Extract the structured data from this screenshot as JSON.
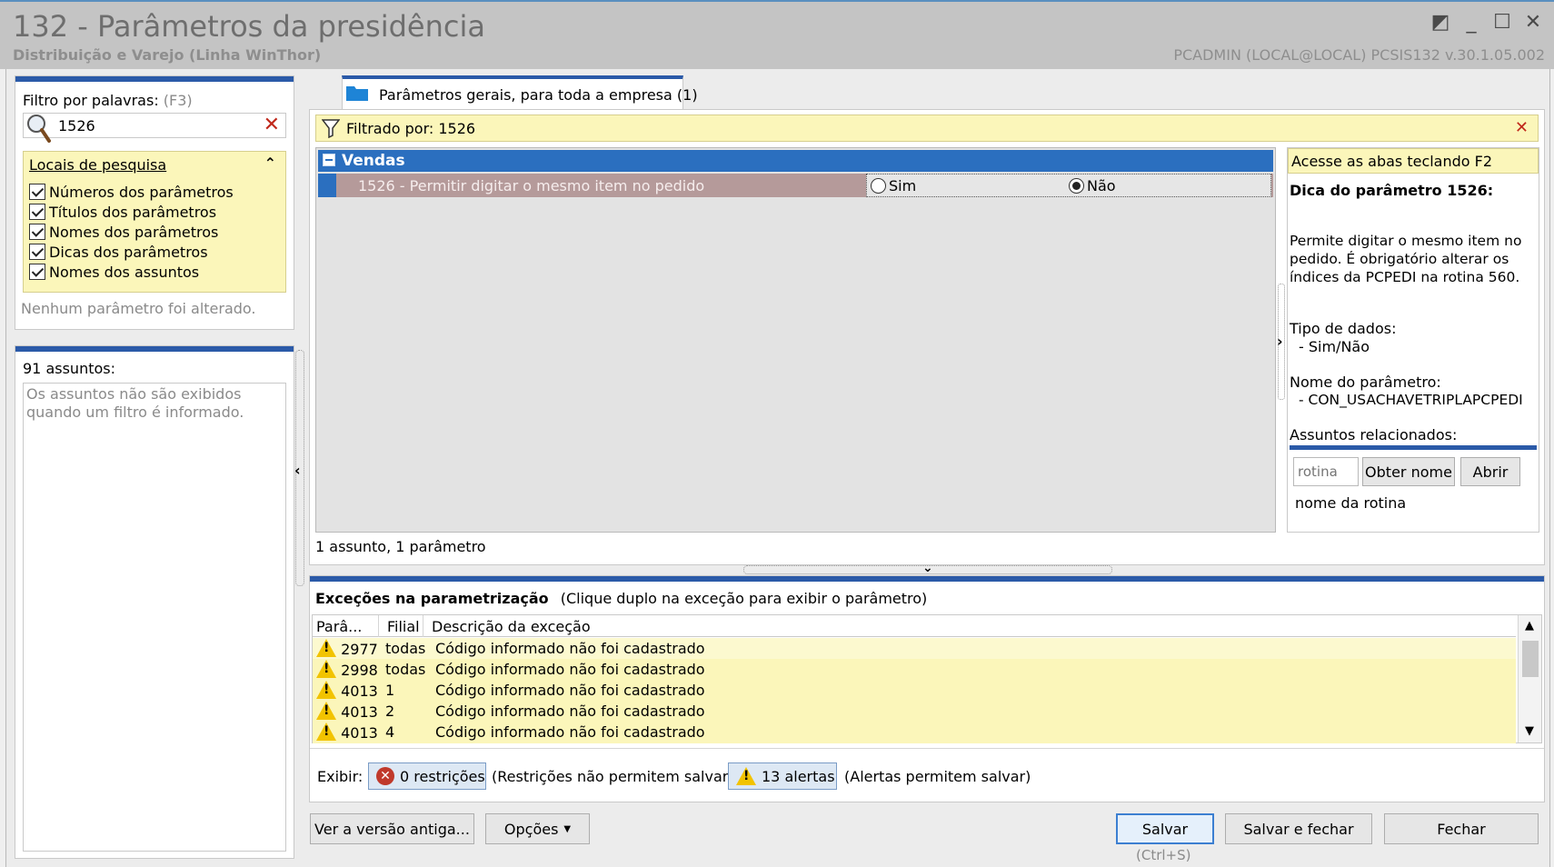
{
  "window": {
    "title": "132 - Parâmetros da presidência",
    "subtitle": "Distribuição e Varejo (Linha WinThor)",
    "user_info": "PCADMIN (LOCAL@LOCAL)   PCSIS132  v.30.1.05.002"
  },
  "filter": {
    "label": "Filtro por palavras:",
    "shortcut": "(F3)",
    "value": "1526",
    "search_places_title": "Locais de pesquisa",
    "options": [
      "Números dos parâmetros",
      "Títulos dos parâmetros",
      "Nomes dos parâmetros",
      "Dicas dos parâmetros",
      "Nomes dos assuntos"
    ],
    "status": "Nenhum parâmetro foi alterado."
  },
  "subjects": {
    "count_label": "91 assuntos:",
    "message": "Os assuntos não são exibidos quando um filtro é informado."
  },
  "tab": {
    "label": "Parâmetros gerais, para toda a empresa  (1)"
  },
  "filter_bar": {
    "label": "Filtrado por: 1526"
  },
  "group": {
    "name": "Vendas",
    "param_label": "1526 - Permitir digitar o mesmo item no pedido",
    "opt_yes": "Sim",
    "opt_no": "Não",
    "selected": "Não"
  },
  "summary": "1 assunto, 1 parâmetro",
  "tips": {
    "hint": "Acesse as abas teclando F2",
    "title": "Dica do parâmetro 1526:",
    "description": "Permite digitar o mesmo item no pedido. É obrigatório alterar os índices da PCPEDI na rotina 560.",
    "data_type_label": "Tipo de dados:",
    "data_type_value": "- Sim/Não",
    "param_name_label": "Nome do parâmetro:",
    "param_name_value": "- CON_USACHAVETRIPLAPCPEDI",
    "related_label": "Assuntos relacionados:",
    "routine_placeholder": "rotina",
    "get_name_button": "Obter nome",
    "open_button": "Abrir",
    "routine_name": "nome da rotina"
  },
  "exceptions": {
    "title": "Exceções na parametrização",
    "subtitle": "(Clique duplo na exceção para exibir o parâmetro)",
    "columns": [
      "Parâ...",
      "Filial",
      "Descrição da exceção"
    ],
    "rows": [
      {
        "param": "2977",
        "branch": "todas",
        "description": "Código informado não foi cadastrado"
      },
      {
        "param": "2998",
        "branch": "todas",
        "description": "Código informado não foi cadastrado"
      },
      {
        "param": "4013",
        "branch": "1",
        "description": "Código informado não foi cadastrado"
      },
      {
        "param": "4013",
        "branch": "2",
        "description": "Código informado não foi cadastrado"
      },
      {
        "param": "4013",
        "branch": "4",
        "description": "Código informado não foi cadastrado"
      }
    ],
    "show_label": "Exibir:",
    "restrictions_button": "0 restrições",
    "restrictions_note": "(Restrições não permitem salvar)",
    "alerts_button": "13 alertas",
    "alerts_note": "(Alertas permitem salvar)"
  },
  "footer": {
    "old_version_button": "Ver a versão antiga...",
    "options_button": "Opções",
    "save_button": "Salvar",
    "save_shortcut": "(Ctrl+S)",
    "save_close_button": "Salvar e fechar",
    "close_button": "Fechar"
  },
  "colors": {
    "accent_blue": "#2b5aa8",
    "highlight_yellow": "#fbf6ba",
    "selected_row": "#b59a9a"
  }
}
